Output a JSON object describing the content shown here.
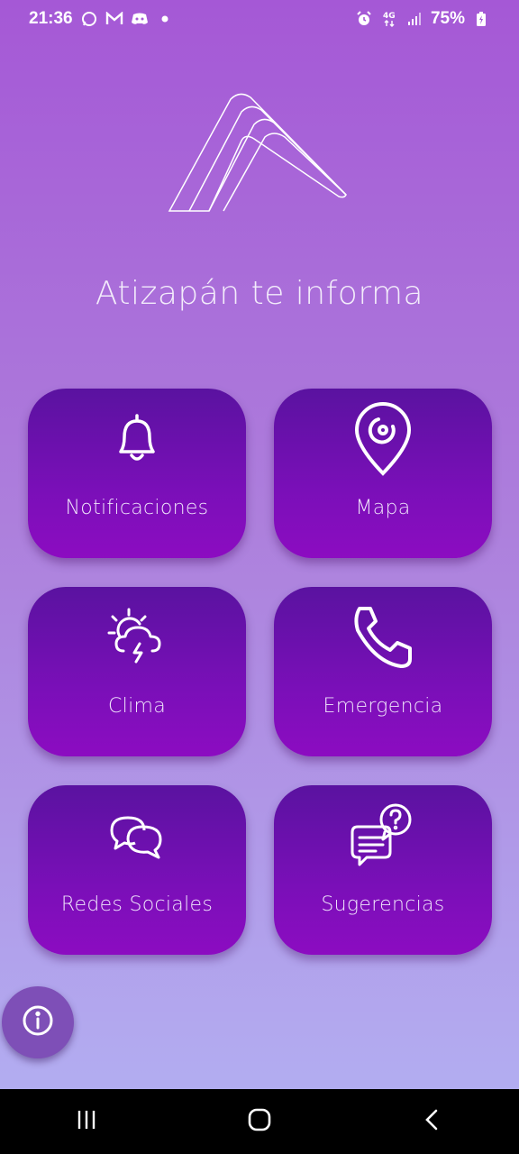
{
  "status_bar": {
    "time": "21:36",
    "notification_icons": [
      "whatsapp-icon",
      "gmail-icon",
      "discord-icon",
      "more-dot-icon"
    ],
    "system_icons": [
      "alarm-icon",
      "4g-data-icon",
      "signal-icon"
    ],
    "battery": "75%"
  },
  "header": {
    "title": "Atizapán te informa"
  },
  "menu": [
    {
      "label": "Notificaciones",
      "icon": "bell-icon"
    },
    {
      "label": "Mapa",
      "icon": "map-pin-icon"
    },
    {
      "label": "Clima",
      "icon": "weather-icon"
    },
    {
      "label": "Emergencia",
      "icon": "phone-icon"
    },
    {
      "label": "Redes Sociales",
      "icon": "chat-bubbles-icon"
    },
    {
      "label": "Sugerencias",
      "icon": "question-chat-icon"
    }
  ],
  "fab": {
    "icon": "info-icon"
  },
  "colors": {
    "tile_top": "#5a12a0",
    "tile_bottom": "#8c0cc1",
    "bg_top": "#a558d6",
    "bg_bottom": "#b3b2f3"
  }
}
